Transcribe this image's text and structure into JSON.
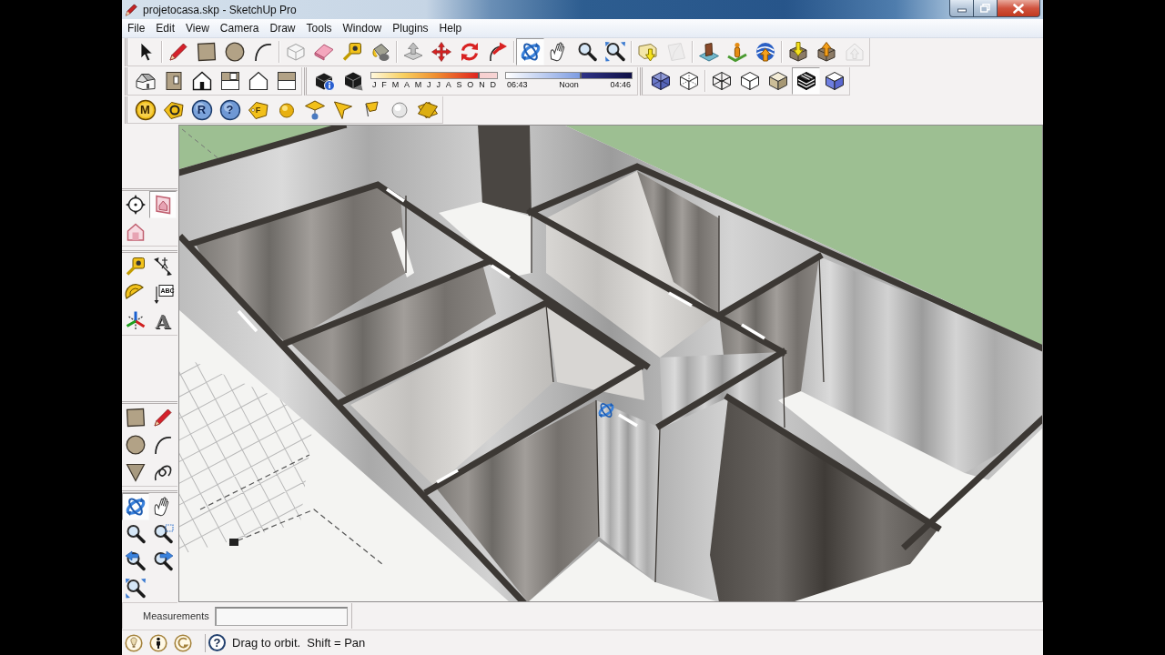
{
  "window": {
    "title": "projetocasa.skp - SketchUp Pro"
  },
  "menu": [
    "File",
    "Edit",
    "View",
    "Camera",
    "Draw",
    "Tools",
    "Window",
    "Plugins",
    "Help"
  ],
  "toolbar_rows": [
    [
      {
        "groups": [
          [
            {
              "kind": "select",
              "selected": false
            }
          ],
          [
            {
              "kind": "pencil",
              "selected": false
            },
            {
              "kind": "rectangle",
              "selected": false
            },
            {
              "kind": "circle",
              "selected": false
            },
            {
              "kind": "arc",
              "selected": false
            }
          ],
          [
            {
              "kind": "component",
              "selected": false
            },
            {
              "kind": "eraser",
              "selected": false
            },
            {
              "kind": "tape",
              "selected": false
            },
            {
              "kind": "paint",
              "selected": false
            }
          ],
          [
            {
              "kind": "pushpull",
              "selected": false
            },
            {
              "kind": "move",
              "selected": false
            },
            {
              "kind": "rotate",
              "selected": false
            },
            {
              "kind": "followme",
              "selected": false
            }
          ],
          [
            {
              "kind": "orbit",
              "selected": true
            },
            {
              "kind": "pan",
              "selected": false
            },
            {
              "kind": "zoom",
              "selected": false
            },
            {
              "kind": "zoomextents",
              "selected": false
            }
          ],
          [
            {
              "kind": "mapimport",
              "disabled": false
            },
            {
              "kind": "sheet",
              "disabled": true
            }
          ],
          [
            {
              "kind": "terrain"
            },
            {
              "kind": "location"
            },
            {
              "kind": "earth"
            }
          ],
          [
            {
              "kind": "download",
              "disabled": false
            },
            {
              "kind": "upload",
              "disabled": false
            },
            {
              "kind": "sharecomponent",
              "disabled": true
            }
          ]
        ]
      }
    ],
    [
      {
        "groups": [
          [
            {
              "kind": "iso"
            },
            {
              "kind": "top"
            },
            {
              "kind": "front"
            },
            {
              "kind": "right"
            },
            {
              "kind": "back"
            },
            {
              "kind": "left"
            }
          ]
        ]
      },
      {
        "groups": [
          [
            {
              "kind": "shadowinfo"
            },
            {
              "kind": "shadows"
            }
          ]
        ],
        "date_slider": {
          "months": [
            "J",
            "F",
            "M",
            "A",
            "M",
            "J",
            "J",
            "A",
            "S",
            "O",
            "N",
            "D"
          ],
          "level": 0.86
        },
        "time_slider": {
          "start": "06:43",
          "middle": "Noon",
          "end": "04:46",
          "level": 0.6
        }
      },
      {
        "groups": [
          [
            {
              "kind": "xray",
              "selected": false
            },
            {
              "kind": "backedges",
              "selected": false
            }
          ],
          [
            {
              "kind": "wireframe",
              "selected": false
            },
            {
              "kind": "hiddenline",
              "selected": false
            },
            {
              "kind": "shaded",
              "selected": false
            },
            {
              "kind": "textured",
              "selected": true
            },
            {
              "kind": "monochrome",
              "selected": false
            }
          ]
        ]
      }
    ],
    [
      {
        "groups": [
          [
            {
              "kind": "mbadge",
              "label": "M"
            },
            {
              "kind": "ringtag"
            },
            {
              "kind": "rbadge",
              "label": "R"
            },
            {
              "kind": "helpbadge",
              "label": "?"
            },
            {
              "kind": "ftag",
              "label": "F"
            },
            {
              "kind": "sphere"
            },
            {
              "kind": "lightdiamond"
            },
            {
              "kind": "flag"
            },
            {
              "kind": "smallflag"
            },
            {
              "kind": "whitesphere"
            },
            {
              "kind": "crossplanes"
            }
          ]
        ]
      }
    ]
  ],
  "side_toolbars": [
    [
      {
        "kind": "compass",
        "selected": false
      },
      {
        "kind": "sectionplanes",
        "selected": true
      },
      {
        "kind": "sectioncuts",
        "selected": false
      }
    ],
    [
      {
        "kind": "tape",
        "selected": false
      },
      {
        "kind": "dimension",
        "selected": false
      },
      {
        "kind": "protractor",
        "selected": false
      },
      {
        "kind": "text",
        "label": "ABC",
        "selected": false
      },
      {
        "kind": "axes",
        "selected": false
      },
      {
        "kind": "text3d",
        "label": "A",
        "selected": false
      }
    ],
    [
      {
        "kind": "rectangle",
        "selected": false
      },
      {
        "kind": "pencil",
        "selected": false
      },
      {
        "kind": "circle",
        "selected": false
      },
      {
        "kind": "arc",
        "selected": false
      },
      {
        "kind": "polygon",
        "selected": false
      },
      {
        "kind": "freehand",
        "selected": false
      }
    ],
    [
      {
        "kind": "orbit",
        "selected": true
      },
      {
        "kind": "pan",
        "selected": false
      },
      {
        "kind": "zoom",
        "selected": false
      },
      {
        "kind": "zoomwindow",
        "selected": false
      },
      {
        "kind": "previous",
        "selected": false
      },
      {
        "kind": "next",
        "selected": false
      },
      {
        "kind": "zoomextents",
        "selected": false
      }
    ]
  ],
  "measurements": {
    "label": "Measurements"
  },
  "status": {
    "help_glyph": "?",
    "text": "Drag to orbit.  Shift = Pan"
  }
}
